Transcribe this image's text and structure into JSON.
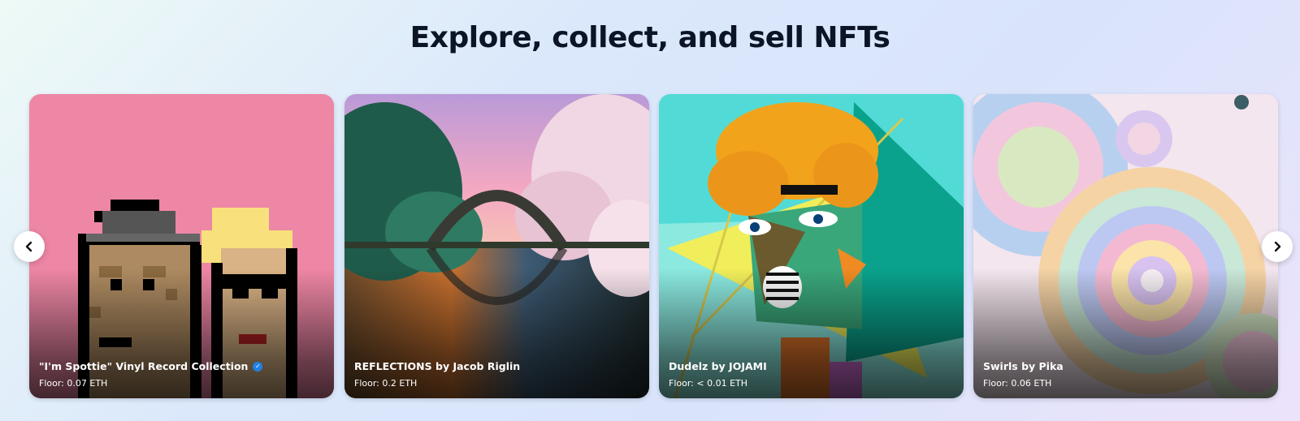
{
  "heading": "Explore, collect, and sell NFTs",
  "carousel": {
    "prev_icon": "chevron-left-icon",
    "next_icon": "chevron-right-icon",
    "cards": [
      {
        "title": "\"I'm Spottie\" Vinyl Record Collection",
        "verified": true,
        "floor": "Floor: 0.07 ETH"
      },
      {
        "title": "REFLECTIONS by Jacob Riglin",
        "verified": false,
        "floor": "Floor: 0.2 ETH"
      },
      {
        "title": "Dudelz by JOJAMI",
        "verified": false,
        "floor": "Floor: < 0.01 ETH"
      },
      {
        "title": "Swirls by Pika",
        "verified": false,
        "floor": "Floor: 0.06 ETH"
      }
    ]
  },
  "colors": {
    "verified_badge": "#2081e2",
    "heading": "#0c1427"
  }
}
